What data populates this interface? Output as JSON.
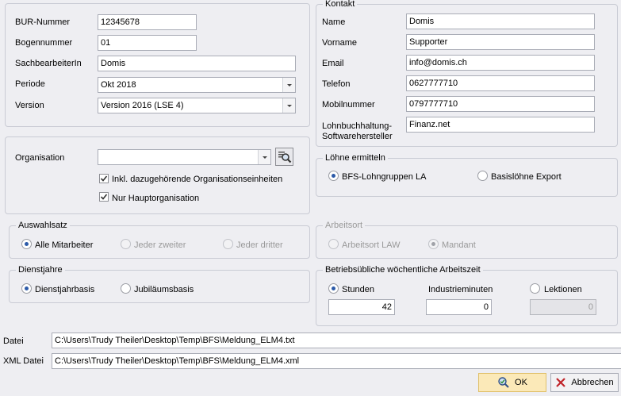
{
  "left": {
    "bur_label": "BUR-Nummer",
    "bur_value": "12345678",
    "bogen_label": "Bogennummer",
    "bogen_value": "01",
    "sach_label": "SachbearbeiterIn",
    "sach_value": "Domis",
    "periode_label": "Periode",
    "periode_value": "Okt 2018",
    "version_label": "Version",
    "version_value": "Version 2016 (LSE 4)"
  },
  "org": {
    "label": "Organisation",
    "value": "",
    "inkl_label": "Inkl. dazugehörende Organisationseinheiten",
    "inkl_checked": true,
    "haupt_label": "Nur Hauptorganisation",
    "haupt_checked": true
  },
  "auswahl": {
    "title": "Auswahlsatz",
    "opt_alle": "Alle Mitarbeiter",
    "opt_zweiter": "Jeder zweiter",
    "opt_dritter": "Jeder dritter",
    "selected": "Alle Mitarbeiter"
  },
  "dienst": {
    "title": "Dienstjahre",
    "opt_basis": "Dienstjahrbasis",
    "opt_jubi": "Jubiläumsbasis",
    "selected": "Dienstjahrbasis"
  },
  "kontakt": {
    "title": "Kontakt",
    "name_label": "Name",
    "name_value": "Domis",
    "vorname_label": "Vorname",
    "vorname_value": "Supporter",
    "email_label": "Email",
    "email_value": "info@domis.ch",
    "telefon_label": "Telefon",
    "telefon_value": "0627777710",
    "mobil_label": "Mobilnummer",
    "mobil_value": "0797777710",
    "lohn_label_1": "Lohnbuchhaltung-",
    "lohn_label_2": "Softwarehersteller",
    "lohn_value": "Finanz.net"
  },
  "loehne": {
    "title": "Löhne ermitteln",
    "opt_bfs": "BFS-Lohngruppen LA",
    "opt_basis": "Basislöhne Export",
    "selected": "BFS-Lohngruppen LA"
  },
  "arbeitsort": {
    "title": "Arbeitsort",
    "opt_law": "Arbeitsort LAW",
    "opt_mandant": "Mandant",
    "selected": "Mandant"
  },
  "arbeitszeit": {
    "title": "Betriebsübliche wöchentliche Arbeitszeit",
    "opt_stunden": "Stunden",
    "industrie_label": "Industrieminuten",
    "opt_lektionen": "Lektionen",
    "stunden_value": "42",
    "industrie_value": "0",
    "lektionen_value": "0",
    "selected": "Stunden"
  },
  "files": {
    "datei_label": "Datei",
    "datei_value": "C:\\Users\\Trudy Theiler\\Desktop\\Temp\\BFS\\Meldung_ELM4.txt",
    "xml_label": "XML Datei",
    "xml_value": "C:\\Users\\Trudy Theiler\\Desktop\\Temp\\BFS\\Meldung_ELM4.xml"
  },
  "buttons": {
    "ok": "OK",
    "cancel": "Abbrechen"
  },
  "icons": [
    "search-icon",
    "ok-icon",
    "cancel-x-icon",
    "checkmark-icon",
    "chevron-down-icon"
  ],
  "colors": {
    "background": "#eeeef2",
    "radio_selected": "#2c5aa8",
    "default_button": "#fbe9b8",
    "cancel_x": "#c0252a"
  }
}
